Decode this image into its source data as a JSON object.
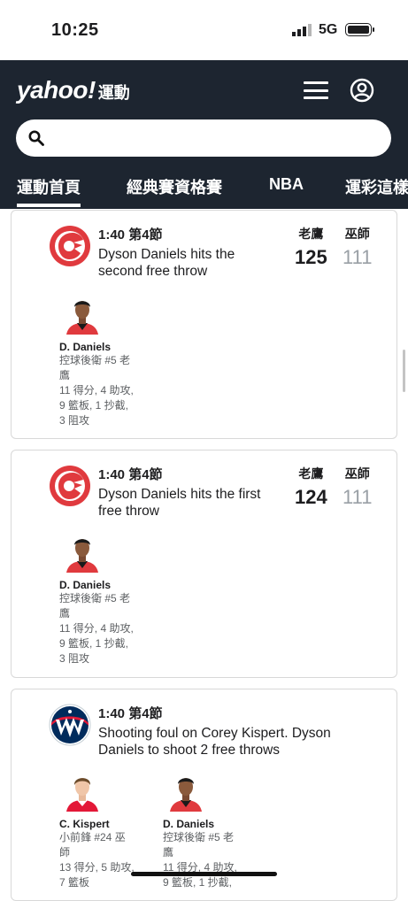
{
  "status": {
    "time": "10:25",
    "network": "5G"
  },
  "header": {
    "logo_main": "yahoo!",
    "logo_sub": "運動",
    "search_placeholder": "",
    "tabs": [
      {
        "label": "運動首頁",
        "active": true
      },
      {
        "label": "經典賽資格賽",
        "active": false
      },
      {
        "label": "NBA",
        "active": false
      },
      {
        "label": "運彩這樣",
        "active": false
      }
    ]
  },
  "colors": {
    "header_bg": "#1d2530",
    "hawks_red": "#e03a3e",
    "wizards_navy": "#002b5c",
    "wizards_red": "#e31837"
  },
  "feed": [
    {
      "team_icon": "hawks-logo-icon",
      "time": "1:40 第4節",
      "description": "Dyson Daniels hits the second free throw",
      "home_label": "老鷹",
      "home_score": "125",
      "away_label": "巫師",
      "away_score": "111",
      "players": [
        {
          "name": "D. Daniels",
          "info": [
            "控球後衛 #5 老",
            "鷹",
            "11 得分, 4 助攻,",
            "9 籃板, 1 抄截,",
            "3 阻攻"
          ]
        }
      ]
    },
    {
      "team_icon": "hawks-logo-icon",
      "time": "1:40 第4節",
      "description": "Dyson Daniels hits the first free throw",
      "home_label": "老鷹",
      "home_score": "124",
      "away_label": "巫師",
      "away_score": "111",
      "players": [
        {
          "name": "D. Daniels",
          "info": [
            "控球後衛 #5 老",
            "鷹",
            "11 得分, 4 助攻,",
            "9 籃板, 1 抄截,",
            "3 阻攻"
          ]
        }
      ]
    },
    {
      "team_icon": "wizards-logo-icon",
      "time": "1:40 第4節",
      "description": "Shooting foul on Corey Kispert. Dyson Daniels to shoot 2 free throws",
      "players": [
        {
          "name": "C. Kispert",
          "info": [
            "小前鋒 #24 巫",
            "師",
            "13 得分, 5 助攻,",
            "7 籃板"
          ]
        },
        {
          "name": "D. Daniels",
          "info": [
            "控球後衛 #5 老",
            "鷹",
            "11 得分, 4 助攻,",
            "9 籃板, 1 抄截,"
          ]
        }
      ]
    }
  ]
}
